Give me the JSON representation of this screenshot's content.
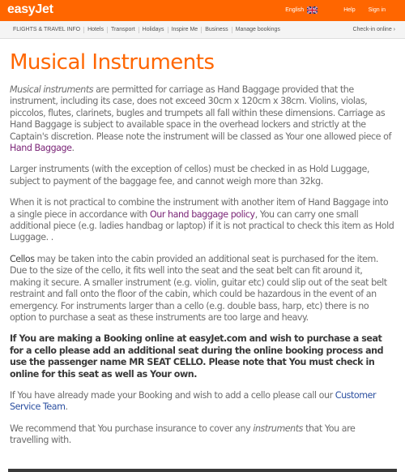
{
  "header": {
    "logo": "easyJet",
    "language": "English",
    "help": "Help",
    "signin": "Sign in"
  },
  "nav": {
    "items": [
      "FLIGHTS & TRAVEL INFO",
      "Hotels",
      "Transport",
      "Holidays",
      "Inspire Me",
      "Business",
      "Manage bookings"
    ],
    "checkin": "Check-in online ›"
  },
  "page": {
    "title": "Musical Instruments",
    "p1": {
      "em": "Musical instruments",
      "text": " are permitted for carriage as Hand Baggage provided that the instrument, including its case, does not exceed 30cm x 120cm x 38cm. Violins, violas, piccolos, flutes, clarinets, bugles and trumpets all fall within these dimensions. Carriage as Hand Baggage is subject to available space in the overhead lockers and strictly at the Captain's discretion. Please note the instrument will be classed as Your one allowed piece of ",
      "link": "Hand Baggage",
      "end": "."
    },
    "p2": "Larger instruments (with the exception of cellos) must be checked in as Hold Luggage, subject to payment of the baggage fee, and cannot weigh more than 32kg.",
    "p3": {
      "text1": "When it is not practical to combine the instrument with another item of Hand Baggage into a single piece in accordance with ",
      "link": "Our hand baggage policy",
      "text2": ", You can carry one small additional piece (e.g. ladies handbag or laptop) if it is not practical to check this item as Hold Luggage. ."
    },
    "p4": {
      "lead": "Cellos",
      "text": " may be taken into the cabin provided an additional seat is purchased for the item. Due to the size of the cello, it fits well into the seat and the seat belt can fit around it, making it secure. A smaller instrument (e.g. violin, guitar etc) could slip out of the seat belt restraint and fall onto the floor of the cabin, which could be hazardous in the event of an emergency. For instruments larger than a cello (e.g. double bass, harp, etc) there is no option to purchase a seat as these instruments are too large and heavy."
    },
    "p5": "If You are making a Booking online at easyJet.com and wish to purchase a seat for a cello please add an additional seat during the online booking process and use the passenger name MR SEAT CELLO. Please note that You must check in online for this seat as well as Your own.",
    "p6": {
      "text": "If You have already made your Booking and wish to add a cello please call our ",
      "link": "Customer Service Team",
      "end": "."
    },
    "p7": {
      "text1": "We recommend that You purchase insurance to cover any ",
      "em": "instruments",
      "text2": " that You are travelling with."
    }
  },
  "colors": {
    "brand": "#ff6600",
    "link_purple": "#7a2577",
    "link_blue": "#2b4fa0"
  }
}
